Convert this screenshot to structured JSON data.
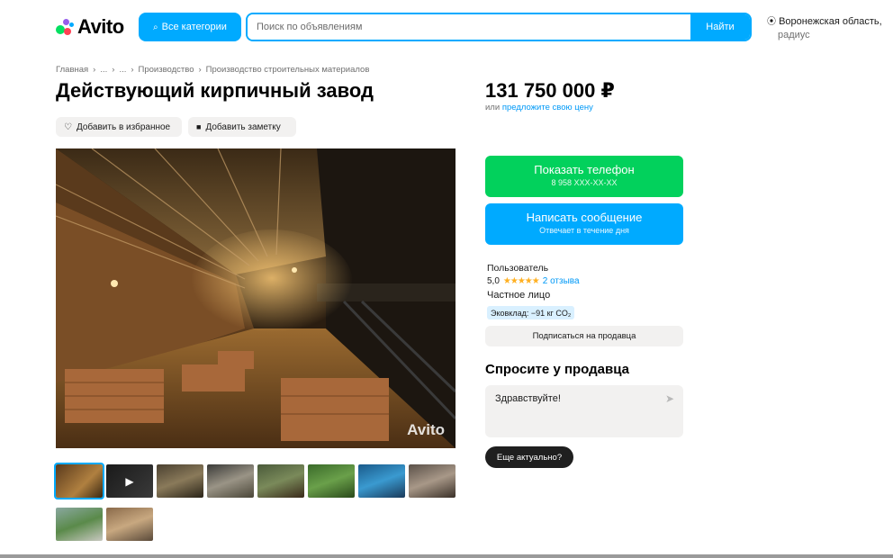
{
  "header": {
    "logo_text": "Avito",
    "categories_label": "Все категории",
    "search_placeholder": "Поиск по объявлениям",
    "search_button": "Найти",
    "region_line1": "Воронежская область,",
    "region_line2": "радиус"
  },
  "breadcrumbs": [
    "Главная",
    "›",
    "...",
    "›",
    "...",
    "›",
    "Производство",
    "›",
    "Производство строительных материалов"
  ],
  "listing": {
    "title": "Действующий кирпичный завод",
    "favorite_label": "Добавить в избранное",
    "note_label": "Добавить заметку",
    "watermark": "Avito",
    "thumbnail_count": 10
  },
  "sidebar": {
    "price": "131 750 000 ₽",
    "price_prefix": "или",
    "price_link": "предложите свою цену",
    "phone_button": "Показать телефон",
    "phone_masked": "8 958 XXX-XX-XX",
    "message_button": "Написать сообщение",
    "message_sub": "Отвечает в течение дня",
    "seller_type": "Пользователь",
    "rating_value": "5,0",
    "rating_stars": "★★★★★",
    "reviews": "2 отзыва",
    "seller_kind": "Частное лицо",
    "eco_badge": "Эковклад: −91 кг CO₂",
    "subscribe": "Подписаться на продавца",
    "ask_title": "Спросите у продавца",
    "ask_text": "Здравствуйте!",
    "quick_reply": "Еще актуально?"
  },
  "colors": {
    "accent_blue": "#00aaff",
    "phone_green": "#02d15c",
    "link_blue": "#0099f7",
    "star_gold": "#ffb021"
  },
  "icons": {
    "search": "search-icon",
    "pin": "location-pin-icon",
    "heart": "heart-icon",
    "note": "note-icon",
    "send": "send-icon",
    "play": "play-icon"
  }
}
